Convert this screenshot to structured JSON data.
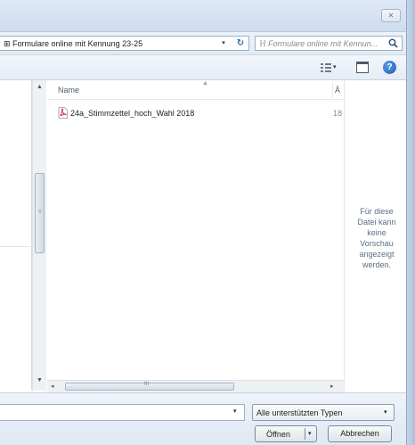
{
  "window": {
    "close_glyph": "✕"
  },
  "address": {
    "path": "⊞ Formulare online mit Kennung 23-25",
    "dropdown_glyph": "▾",
    "refresh_glyph": "↻",
    "search_placeholder": "ℍ Formulare online mit Kennun..."
  },
  "toolbar": {
    "view_dropdown_glyph": "▾",
    "help_label": "?"
  },
  "filelist": {
    "columns": [
      "Name",
      "Ä"
    ],
    "sort_glyph": "▲",
    "files": [
      {
        "name": "24a_Stimmzettel_hoch_Wahl 2018",
        "date_fragment": "18",
        "type_icon": "pdf-icon"
      }
    ]
  },
  "scrollbars": {
    "up_glyph": "▲",
    "down_glyph": "▼",
    "left_glyph": "◂",
    "right_glyph": "▸",
    "grip_v": "≡",
    "grip_h": "III"
  },
  "preview": {
    "message": "Für diese Datei kann keine Vorschau angezeigt werden."
  },
  "footer": {
    "filename_value": "",
    "filename_dropdown_glyph": "▾",
    "file_type": "Alle unterstützten Typen",
    "file_type_dropdown_glyph": "▾",
    "open_label": "Öffnen",
    "open_dropdown_glyph": "▾",
    "cancel_label": "Abbrechen"
  },
  "colors": {
    "accent": "#2a67b7",
    "pdf_red": "#c8252c"
  }
}
